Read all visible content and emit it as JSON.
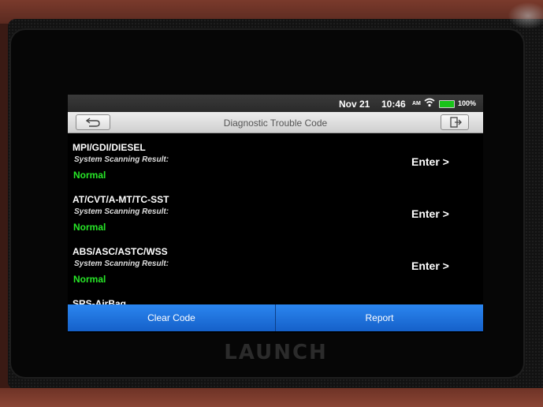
{
  "brand": "LAUNCH",
  "status_bar": {
    "date": "Nov 21",
    "time": "10:46",
    "ampm": "AM",
    "battery": "100%",
    "wifi_icon": "wifi-icon",
    "battery_icon": "battery-icon"
  },
  "header": {
    "title": "Diagnostic Trouble Code",
    "back_icon": "back-arrow-icon",
    "exit_icon": "exit-icon"
  },
  "systems": [
    {
      "name": "MPI/GDI/DIESEL",
      "result_label": "System Scanning Result:",
      "result": "Normal",
      "action": "Enter >"
    },
    {
      "name": "AT/CVT/A-MT/TC-SST",
      "result_label": "System Scanning Result:",
      "result": "Normal",
      "action": "Enter >"
    },
    {
      "name": "ABS/ASC/ASTC/WSS",
      "result_label": "System Scanning Result:",
      "result": "Normal",
      "action": "Enter >"
    },
    {
      "name": "SRS-AirBag",
      "result_label": "",
      "result": "",
      "action": ""
    }
  ],
  "footer": {
    "clear_code": "Clear Code",
    "report": "Report"
  },
  "colors": {
    "accent": "#2b86f0",
    "status_normal": "#27e627",
    "battery": "#19c419"
  }
}
